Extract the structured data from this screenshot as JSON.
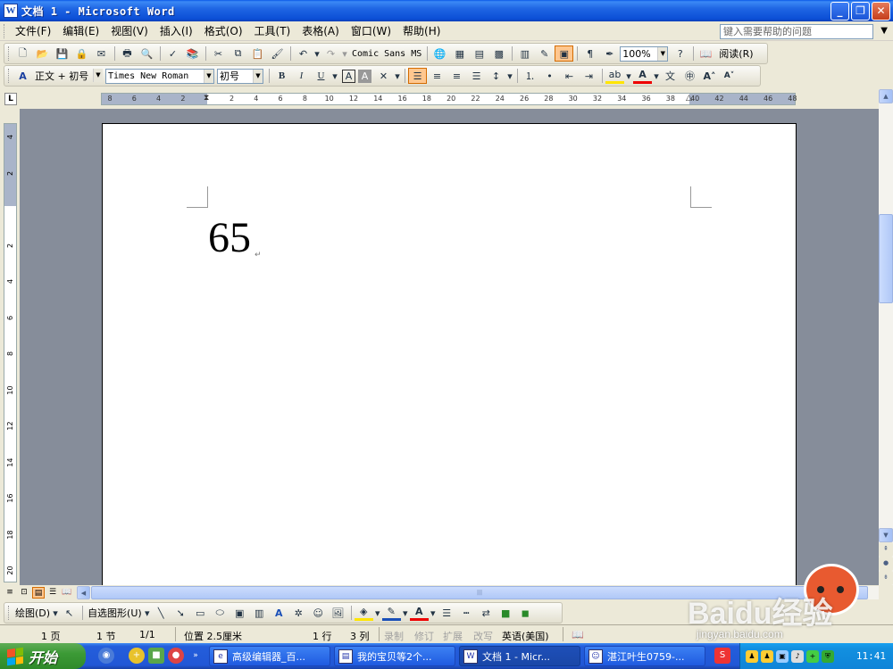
{
  "window": {
    "title": "文档 1 - Microsoft Word",
    "min_glyph": "_",
    "max_glyph": "❐",
    "close_glyph": "✕"
  },
  "menu": {
    "items": [
      "文件(F)",
      "编辑(E)",
      "视图(V)",
      "插入(I)",
      "格式(O)",
      "工具(T)",
      "表格(A)",
      "窗口(W)",
      "帮助(H)"
    ],
    "help_placeholder": "键入需要帮助的问题"
  },
  "standard_toolbar": {
    "font_preview": "Comic Sans MS",
    "zoom": "100%",
    "read_label": "阅读(R)"
  },
  "format_toolbar": {
    "style": "正文 + 初号",
    "font": "Times New Roman",
    "size": "初号",
    "bold": "B",
    "italic": "I",
    "underline": "U"
  },
  "ruler": {
    "corner": "L",
    "h_numbers": [
      "8",
      "6",
      "4",
      "2",
      "",
      "2",
      "4",
      "6",
      "8",
      "10",
      "12",
      "14",
      "16",
      "18",
      "20",
      "22",
      "24",
      "26",
      "28",
      "30",
      "32",
      "34",
      "36",
      "38",
      "40",
      "42",
      "44",
      "46",
      "48"
    ],
    "v_numbers": [
      "4",
      "2",
      "",
      "2",
      "4",
      "6",
      "8",
      "10",
      "12",
      "14",
      "16",
      "18",
      "20"
    ]
  },
  "document": {
    "text": "65",
    "para_mark": "↵"
  },
  "drawing_toolbar": {
    "draw_label": "绘图(D)",
    "autoshapes_label": "自选图形(U)"
  },
  "status": {
    "page": "1 页",
    "section": "1 节",
    "page_of": "1/1",
    "position": "位置 2.5厘米",
    "line": "1 行",
    "column": "3 列",
    "rec": "录制",
    "trk": "修订",
    "ext": "扩展",
    "ovr": "改写",
    "language": "英语(美国)"
  },
  "taskbar": {
    "start_label": "开始",
    "tasks": [
      "高级编辑器_百...",
      "我的宝贝等2个...",
      "文档 1 - Micr...",
      "湛江叶生0759-..."
    ],
    "clock": "11:41"
  },
  "watermark": {
    "brand": "Baidu经验",
    "url": "jingyan.baidu.com"
  }
}
